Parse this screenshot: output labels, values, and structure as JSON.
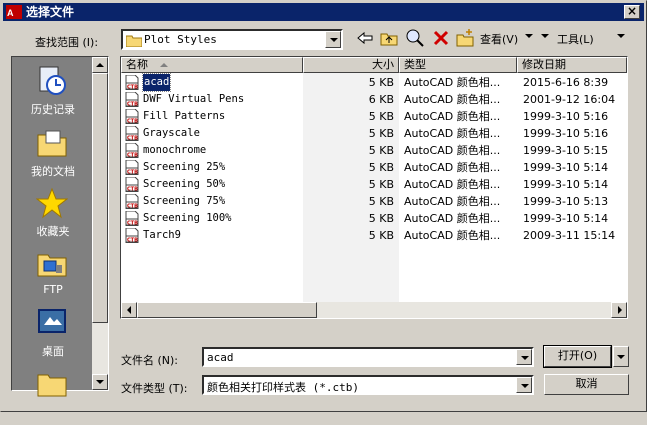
{
  "window": {
    "title": "选择文件",
    "close_glyph": "×"
  },
  "lookin": {
    "label": "查找范围 (I):",
    "value": "Plot Styles"
  },
  "toolbar": {
    "views_label": "查看(V)",
    "tools_label": "工具(L)"
  },
  "places": [
    {
      "label": "历史记录",
      "icon": "history-icon"
    },
    {
      "label": "我的文档",
      "icon": "documents-icon"
    },
    {
      "label": "收藏夹",
      "icon": "favorites-icon"
    },
    {
      "label": "FTP",
      "icon": "ftp-icon"
    },
    {
      "label": "桌面",
      "icon": "desktop-icon"
    }
  ],
  "columns": {
    "name": "名称",
    "size": "大小",
    "type": "类型",
    "modified": "修改日期"
  },
  "files": [
    {
      "name": "acad",
      "size": "5 KB",
      "type": "AutoCAD 颜色相...",
      "modified": "2015-6-16 8:39"
    },
    {
      "name": "DWF Virtual Pens",
      "size": "6 KB",
      "type": "AutoCAD 颜色相...",
      "modified": "2001-9-12 16:04"
    },
    {
      "name": "Fill Patterns",
      "size": "5 KB",
      "type": "AutoCAD 颜色相...",
      "modified": "1999-3-10 5:16"
    },
    {
      "name": "Grayscale",
      "size": "5 KB",
      "type": "AutoCAD 颜色相...",
      "modified": "1999-3-10 5:16"
    },
    {
      "name": "monochrome",
      "size": "5 KB",
      "type": "AutoCAD 颜色相...",
      "modified": "1999-3-10 5:15"
    },
    {
      "name": "Screening 25%",
      "size": "5 KB",
      "type": "AutoCAD 颜色相...",
      "modified": "1999-3-10 5:14"
    },
    {
      "name": "Screening 50%",
      "size": "5 KB",
      "type": "AutoCAD 颜色相...",
      "modified": "1999-3-10 5:14"
    },
    {
      "name": "Screening 75%",
      "size": "5 KB",
      "type": "AutoCAD 颜色相...",
      "modified": "1999-3-10 5:13"
    },
    {
      "name": "Screening 100%",
      "size": "5 KB",
      "type": "AutoCAD 颜色相...",
      "modified": "1999-3-10 5:14"
    },
    {
      "name": "Tarch9",
      "size": "5 KB",
      "type": "AutoCAD 颜色相...",
      "modified": "2009-3-11 15:14"
    }
  ],
  "filename": {
    "label": "文件名 (N):",
    "value": "acad"
  },
  "filetype": {
    "label": "文件类型 (T):",
    "value": "颜色相关打印样式表 (*.ctb)"
  },
  "buttons": {
    "open": "打开(O)",
    "cancel": "取消"
  },
  "colors": {
    "titlebar": "#0a246a",
    "face": "#d4d0c8",
    "selection": "#0a246a"
  }
}
